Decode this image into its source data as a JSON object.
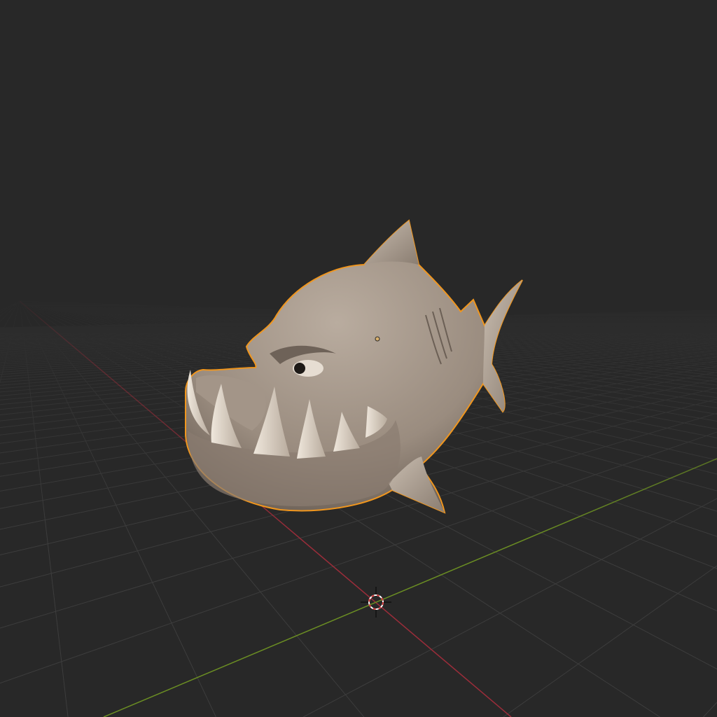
{
  "viewport": {
    "background": "#282828",
    "grid_color": "#3d3d3d",
    "x_axis_color": "#9b2d3a",
    "y_axis_color": "#6b8e23"
  },
  "object": {
    "selected": true,
    "outline_color": "#f0961e",
    "body_light": "#b3a699",
    "body_dark": "#6f6257",
    "teeth_color": "#ddd3c6"
  },
  "cursor_3d": {
    "ring_color": "#d33b3b",
    "ring_alt_color": "#ffffff"
  }
}
